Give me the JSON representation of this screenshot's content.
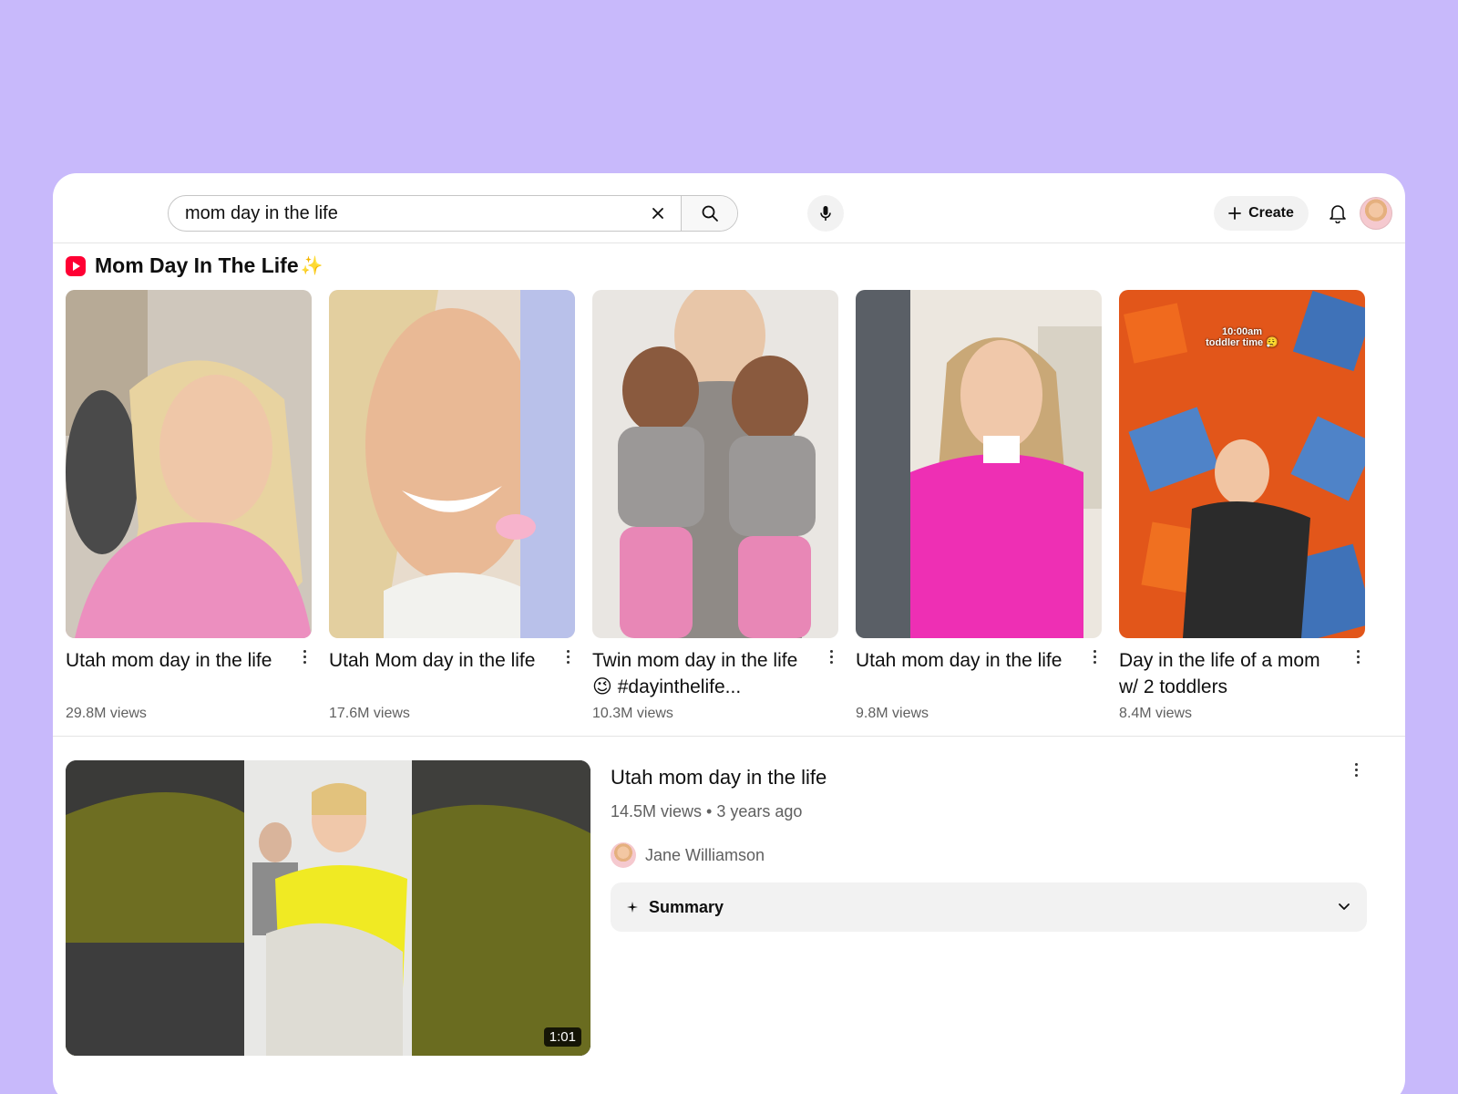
{
  "search": {
    "query": "mom day in the life"
  },
  "header": {
    "create_label": "Create"
  },
  "shorts_section": {
    "title": "Mom Day In The Life",
    "sparkle": "✨",
    "items": [
      {
        "title": "Utah mom day in the life",
        "views": "29.8M views"
      },
      {
        "title": "Utah Mom day in the life",
        "views": "17.6M views"
      },
      {
        "title": "Twin mom day in the life 😉 #dayinthelife...",
        "views": "10.3M views"
      },
      {
        "title": "Utah mom day in the life",
        "views": "9.8M views"
      },
      {
        "title": "Day in the life of a mom w/ 2 toddlers",
        "views": "8.4M views",
        "overlay": "10:00am\ntoddler time 😮‍💨"
      }
    ]
  },
  "video": {
    "title": "Utah mom day in the life",
    "meta": "14.5M views • 3 years ago",
    "channel": "Jane Williamson",
    "duration": "1:01",
    "summary_label": "Summary"
  }
}
